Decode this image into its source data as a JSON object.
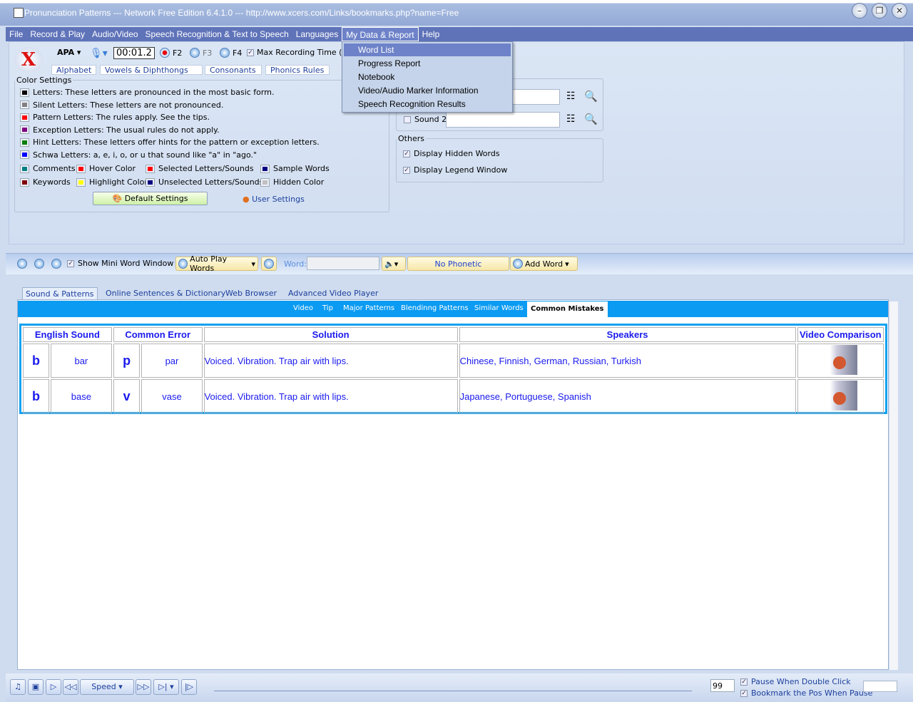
{
  "window": {
    "title": "Pronunciation Patterns --- Network Free Edition 6.4.1.0 --- http://www.xcers.com/Links/bookmarks.php?name=Free",
    "min": "–",
    "max": "❐",
    "close": "✕"
  },
  "menubar": [
    "File",
    "Record & Play",
    "Audio/Video",
    "Speech Recognition & Text to Speech",
    "Languages",
    "My Data & Report",
    "Help"
  ],
  "dropdown": [
    "Word List",
    "Progress Report",
    "Notebook",
    "Video/Audio Marker Information",
    "Speech Recognition Results"
  ],
  "toolbar": {
    "phonetic": "APA ▾",
    "timer": "00:01.2",
    "f2": "F2",
    "f3": "F3",
    "f4": "F4",
    "max_rec": "Max Recording Time (Se"
  },
  "top_tabs": [
    "Alphabet",
    "Vowels & Diphthongs",
    "Consonants",
    "Phonics Rules"
  ],
  "color_settings": {
    "title": "Color Settings",
    "lines": [
      {
        "text": "Letters: These letters are pronounced in the most basic form.",
        "color": "#000000"
      },
      {
        "text": "Silent Letters: These letters are not pronounced.",
        "color": "#808080"
      },
      {
        "text": "Pattern Letters: The rules apply. See the tips.",
        "color": "#ff0000"
      },
      {
        "text": "Exception Letters: The usual rules do not apply.",
        "color": "#800080"
      },
      {
        "text": "Hint Letters: These letters offer hints for the pattern or exception letters.",
        "color": "#008000"
      },
      {
        "text": "Schwa Letters: a, e, i, o, or u that sound like \"a\" in \"ago.\"",
        "color": "#0000ff"
      }
    ],
    "grid": [
      {
        "text": "Comments",
        "color": "#008080"
      },
      {
        "text": "Hover Color",
        "color": "#ff0000"
      },
      {
        "text": "Selected Letters/Sounds",
        "color": "#ff0000"
      },
      {
        "text": "Sample Words",
        "color": "#000080"
      },
      {
        "text": "Keywords",
        "color": "#800000"
      },
      {
        "text": "Highlight Color",
        "color": "#ffff00"
      },
      {
        "text": "Unselected Letters/Sounds",
        "color": "#000080"
      },
      {
        "text": "Hidden Color",
        "color": "#c0c0c0"
      }
    ],
    "default_btn": "Default Settings",
    "user_settings": "User Settings"
  },
  "sound": {
    "sound2": "Sound 2",
    "sound1_value": "",
    "sound2_value": ""
  },
  "others": {
    "title": "Others",
    "hidden_words": "Display Hidden Words",
    "legend_window": "Display Legend Window"
  },
  "toolbar2": {
    "mini_word": "Show Mini Word Window",
    "auto_play": "Auto Play Words",
    "word_label": "Word:",
    "word_value": "",
    "no_phonetic": "No Phonetic",
    "add_word": "Add Word"
  },
  "main_tabs": [
    "Sound & Patterns",
    "Online Sentences & Dictionary",
    "Web Browser",
    "Advanced Video Player"
  ],
  "sub_tabs": [
    "Video",
    "Tip",
    "Major Patterns",
    "Blendinng Patterns",
    "Similar Words",
    "Common Mistakes"
  ],
  "table": {
    "headers": [
      "English Sound",
      "Common Error",
      "Solution",
      "Speakers",
      "Video Comparison"
    ],
    "rows": [
      {
        "sound": "b",
        "sound_word": "bar",
        "error": "p",
        "error_word": "par",
        "solution": "Voiced. Vibration. Trap air with lips.",
        "speakers": "Chinese, Finnish, German, Russian, Turkish"
      },
      {
        "sound": "b",
        "sound_word": "base",
        "error": "v",
        "error_word": "vase",
        "solution": "Voiced. Vibration. Trap air with lips.",
        "speakers": "Japanese, Portuguese, Spanish"
      }
    ]
  },
  "bottom": {
    "speed": "Speed",
    "volume": "99",
    "pause_dbl": "Pause When Double Click",
    "bookmark": "Bookmark the Pos When Pause"
  }
}
